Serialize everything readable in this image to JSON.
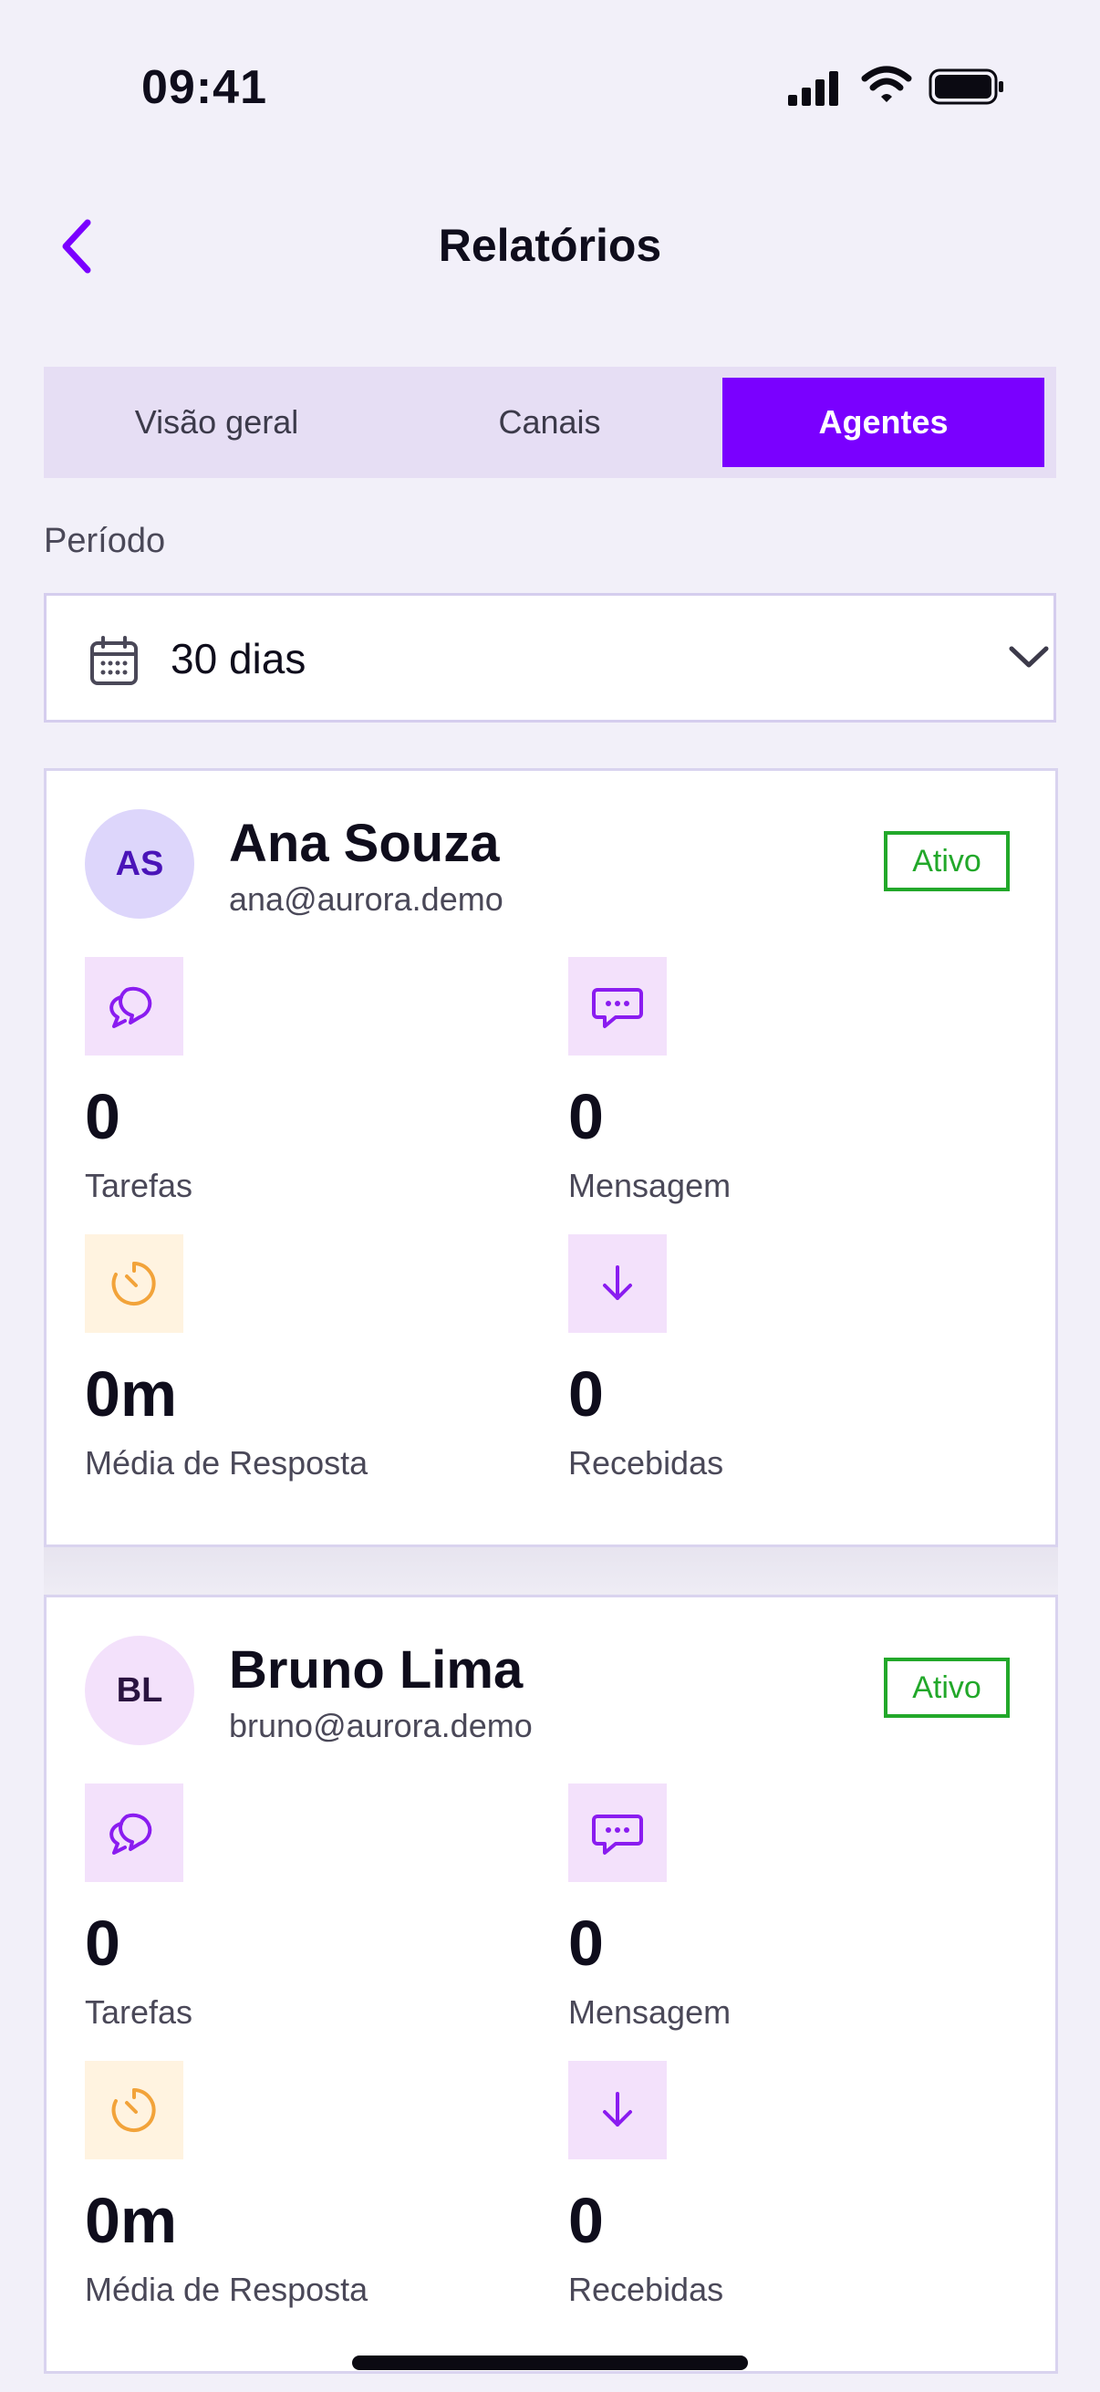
{
  "status_bar": {
    "time": "09:41"
  },
  "header": {
    "title": "Relatórios"
  },
  "tabs": [
    {
      "label": "Visão geral",
      "active": false
    },
    {
      "label": "Canais",
      "active": false
    },
    {
      "label": "Agentes",
      "active": true
    }
  ],
  "period": {
    "label": "Período",
    "value": "30 dias"
  },
  "agents": [
    {
      "initials": "AS",
      "name": "Ana Souza",
      "email": "ana@aurora.demo",
      "status": "Ativo",
      "stats": {
        "tasks": {
          "value": "0",
          "label": "Tarefas"
        },
        "messages": {
          "value": "0",
          "label": "Mensagem"
        },
        "avg_response": {
          "value": "0m",
          "label": "Média de Resposta"
        },
        "received": {
          "value": "0",
          "label": "Recebidas"
        }
      }
    },
    {
      "initials": "BL",
      "name": "Bruno Lima",
      "email": "bruno@aurora.demo",
      "status": "Ativo",
      "stats": {
        "tasks": {
          "value": "0",
          "label": "Tarefas"
        },
        "messages": {
          "value": "0",
          "label": "Mensagem"
        },
        "avg_response": {
          "value": "0m",
          "label": "Média de Resposta"
        },
        "received": {
          "value": "0",
          "label": "Recebidas"
        }
      }
    }
  ],
  "colors": {
    "accent": "#7a00ff",
    "active_badge": "#22a82a",
    "background": "#f2f0f9",
    "timer_icon": "#f2a33a"
  },
  "icons": [
    "back-chevron-icon",
    "calendar-icon",
    "chevron-down-icon",
    "chat-bubbles-icon",
    "message-dots-icon",
    "timer-icon",
    "arrow-down-icon"
  ]
}
